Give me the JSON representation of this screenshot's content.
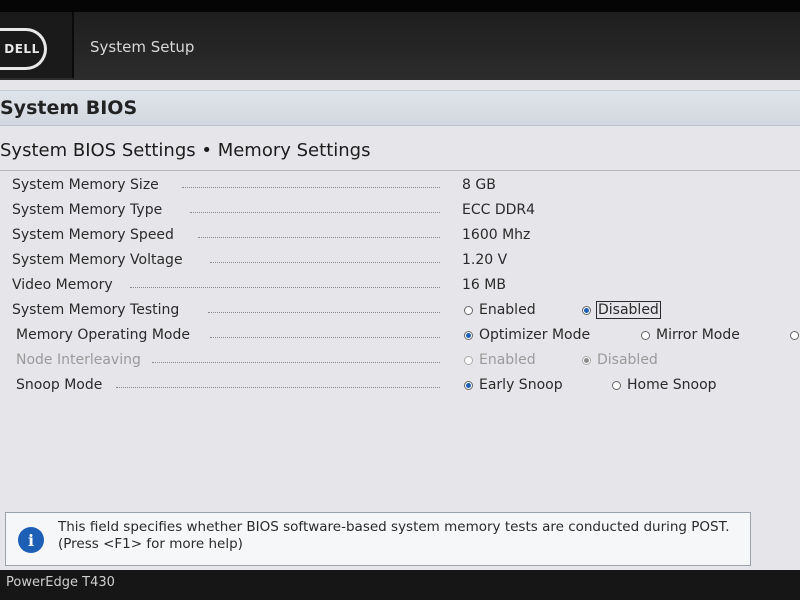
{
  "header": {
    "logo": "DELL",
    "app_title": "System Setup"
  },
  "page": {
    "title": "System BIOS",
    "subtitle": "System BIOS Settings • Memory Settings"
  },
  "settings": [
    {
      "label": "System Memory Size",
      "value": "8 GB"
    },
    {
      "label": "System Memory Type",
      "value": "ECC DDR4"
    },
    {
      "label": "System Memory Speed",
      "value": "1600 Mhz"
    },
    {
      "label": "System Memory Voltage",
      "value": "1.20 V"
    },
    {
      "label": "Video Memory",
      "value": "16 MB"
    },
    {
      "label": "System Memory Testing",
      "options": [
        {
          "label": "Enabled",
          "selected": false
        },
        {
          "label": "Disabled",
          "selected": true
        }
      ]
    },
    {
      "label": "Memory Operating Mode",
      "options": [
        {
          "label": "Optimizer Mode",
          "selected": true
        },
        {
          "label": "Mirror Mode",
          "selected": false
        }
      ]
    },
    {
      "label": "Node Interleaving",
      "disabled": true,
      "options": [
        {
          "label": "Enabled",
          "selected": false
        },
        {
          "label": "Disabled",
          "selected": true
        }
      ]
    },
    {
      "label": "Snoop Mode",
      "options": [
        {
          "label": "Early Snoop",
          "selected": true
        },
        {
          "label": "Home Snoop",
          "selected": false
        }
      ]
    }
  ],
  "help": {
    "icon": "info-icon",
    "text": "This field specifies whether BIOS software-based system memory tests are conducted during POST. (Press <F1> for more help)"
  },
  "footer": {
    "model": "PowerEdge T430"
  },
  "colors": {
    "accent": "#1d5fb5",
    "panel": "#e6e6ea",
    "header": "#232323"
  }
}
